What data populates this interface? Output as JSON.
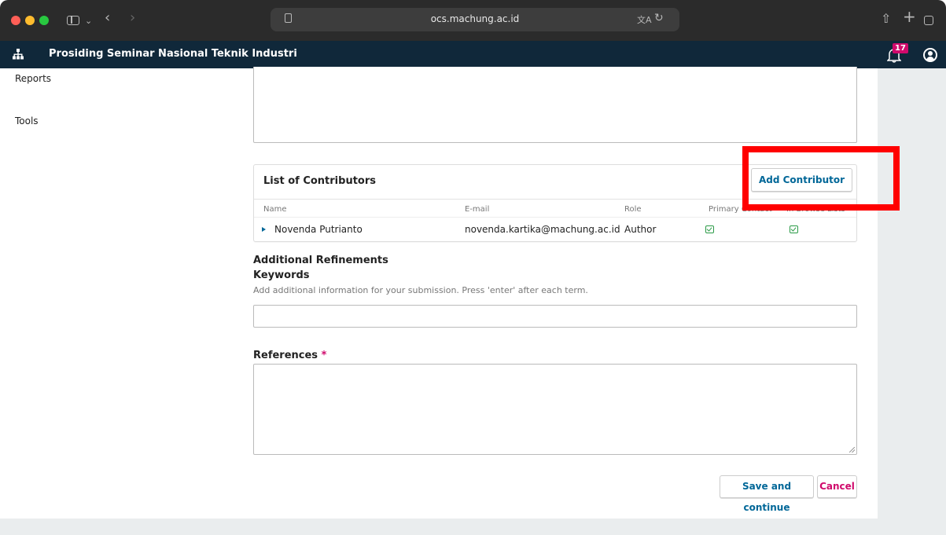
{
  "browser": {
    "url": "ocs.machung.ac.id"
  },
  "app": {
    "site_title": "Prosiding Seminar Nasional Teknik Industri",
    "notification_count": "17"
  },
  "sidebar": {
    "items": [
      {
        "label": "Reports"
      },
      {
        "label": "Tools"
      }
    ]
  },
  "contributors": {
    "title": "List of Contributors",
    "add_button_label": "Add Contributor",
    "columns": [
      "Name",
      "E-mail",
      "Role",
      "Primary Contact",
      "In Browse Lists"
    ],
    "rows": [
      {
        "name": "Novenda Putrianto",
        "email": "novenda.kartika@machung.ac.id",
        "role": "Author",
        "primary_contact": true,
        "in_browse_lists": true
      }
    ]
  },
  "refinements": {
    "title": "Additional Refinements",
    "keywords_label": "Keywords",
    "keywords_description": "Add additional information for your submission. Press 'enter' after each term.",
    "keywords_value": ""
  },
  "references": {
    "label": "References",
    "required_marker": "*",
    "value": ""
  },
  "actions": {
    "save_label": "Save and continue",
    "cancel_label": "Cancel"
  },
  "colors": {
    "header_bg": "#10283a",
    "link_blue": "#006798",
    "accent_pink": "#d00a6c",
    "check_green": "#2a9a46",
    "highlight_red": "#ff0000"
  }
}
